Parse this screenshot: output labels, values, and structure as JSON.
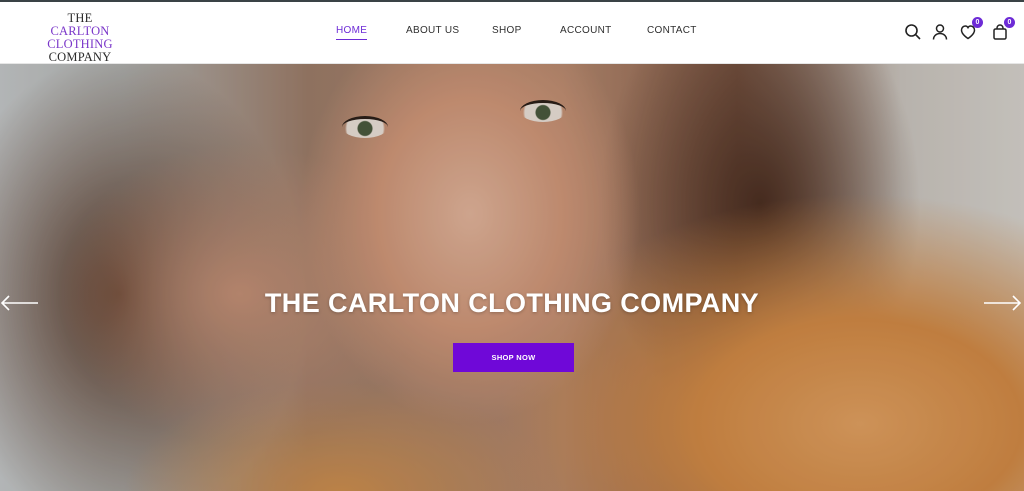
{
  "logo": {
    "line1": "THE",
    "line2": "CARLTON CLOTHING",
    "line3": "COMPANY"
  },
  "nav": {
    "items": [
      {
        "label": "HOME",
        "active": true
      },
      {
        "label": "ABOUT US",
        "active": false
      },
      {
        "label": "SHOP",
        "active": false
      },
      {
        "label": "ACCOUNT",
        "active": false
      },
      {
        "label": "CONTACT",
        "active": false
      }
    ]
  },
  "header_icons": {
    "search": "search-icon",
    "account": "user-icon",
    "wishlist": {
      "icon": "heart-icon",
      "count": "0"
    },
    "cart": {
      "icon": "bag-icon",
      "count": "0"
    }
  },
  "hero": {
    "title": "THE CARLTON CLOTHING COMPANY",
    "cta_label": "SHOP NOW",
    "prev_icon": "arrow-left-icon",
    "next_icon": "arrow-right-icon"
  },
  "colors": {
    "accent": "#6f08d8",
    "nav_active": "#6d2bd6",
    "text": "#2f2f2f"
  }
}
